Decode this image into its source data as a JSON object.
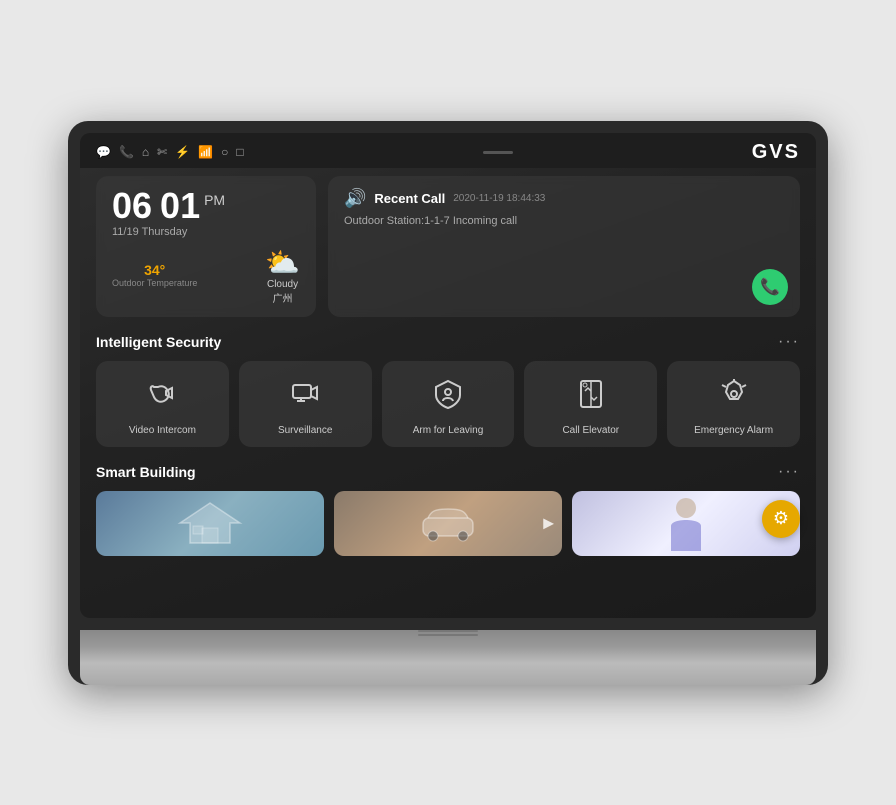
{
  "device": {
    "brand": "GVS"
  },
  "topbar": {
    "icons": [
      "💬",
      "📞",
      "🏠",
      "✂",
      "⚡",
      "📶",
      "○",
      "□"
    ]
  },
  "time_widget": {
    "hour": "06",
    "minute": "01",
    "ampm": "PM",
    "date": "11/19  Thursday",
    "temperature": "34°",
    "temp_label": "Outdoor Temperature",
    "weather_desc": "Cloudy",
    "city": "广州"
  },
  "recent_call": {
    "title": "Recent Call",
    "timestamp": "2020-11-19 18:44:33",
    "detail": "Outdoor Station:1-1-7 Incoming call",
    "call_button_label": "📞"
  },
  "intelligent_security": {
    "section_title": "Intelligent Security",
    "more_label": "···",
    "tiles": [
      {
        "icon": "📞",
        "label": "Video Intercom"
      },
      {
        "icon": "📷",
        "label": "Surveillance"
      },
      {
        "icon": "🏠",
        "label": "Arm for Leaving"
      },
      {
        "icon": "🛗",
        "label": "Call Elevator"
      },
      {
        "icon": "🚨",
        "label": "Emergency Alarm"
      }
    ]
  },
  "smart_building": {
    "section_title": "Smart Building",
    "more_label": "···",
    "thumbnails": [
      {
        "name": "building-thumb-1",
        "type": "house"
      },
      {
        "name": "building-thumb-2",
        "type": "car"
      },
      {
        "name": "building-thumb-3",
        "type": "person"
      }
    ]
  },
  "settings_fab": {
    "icon": "⚙"
  }
}
